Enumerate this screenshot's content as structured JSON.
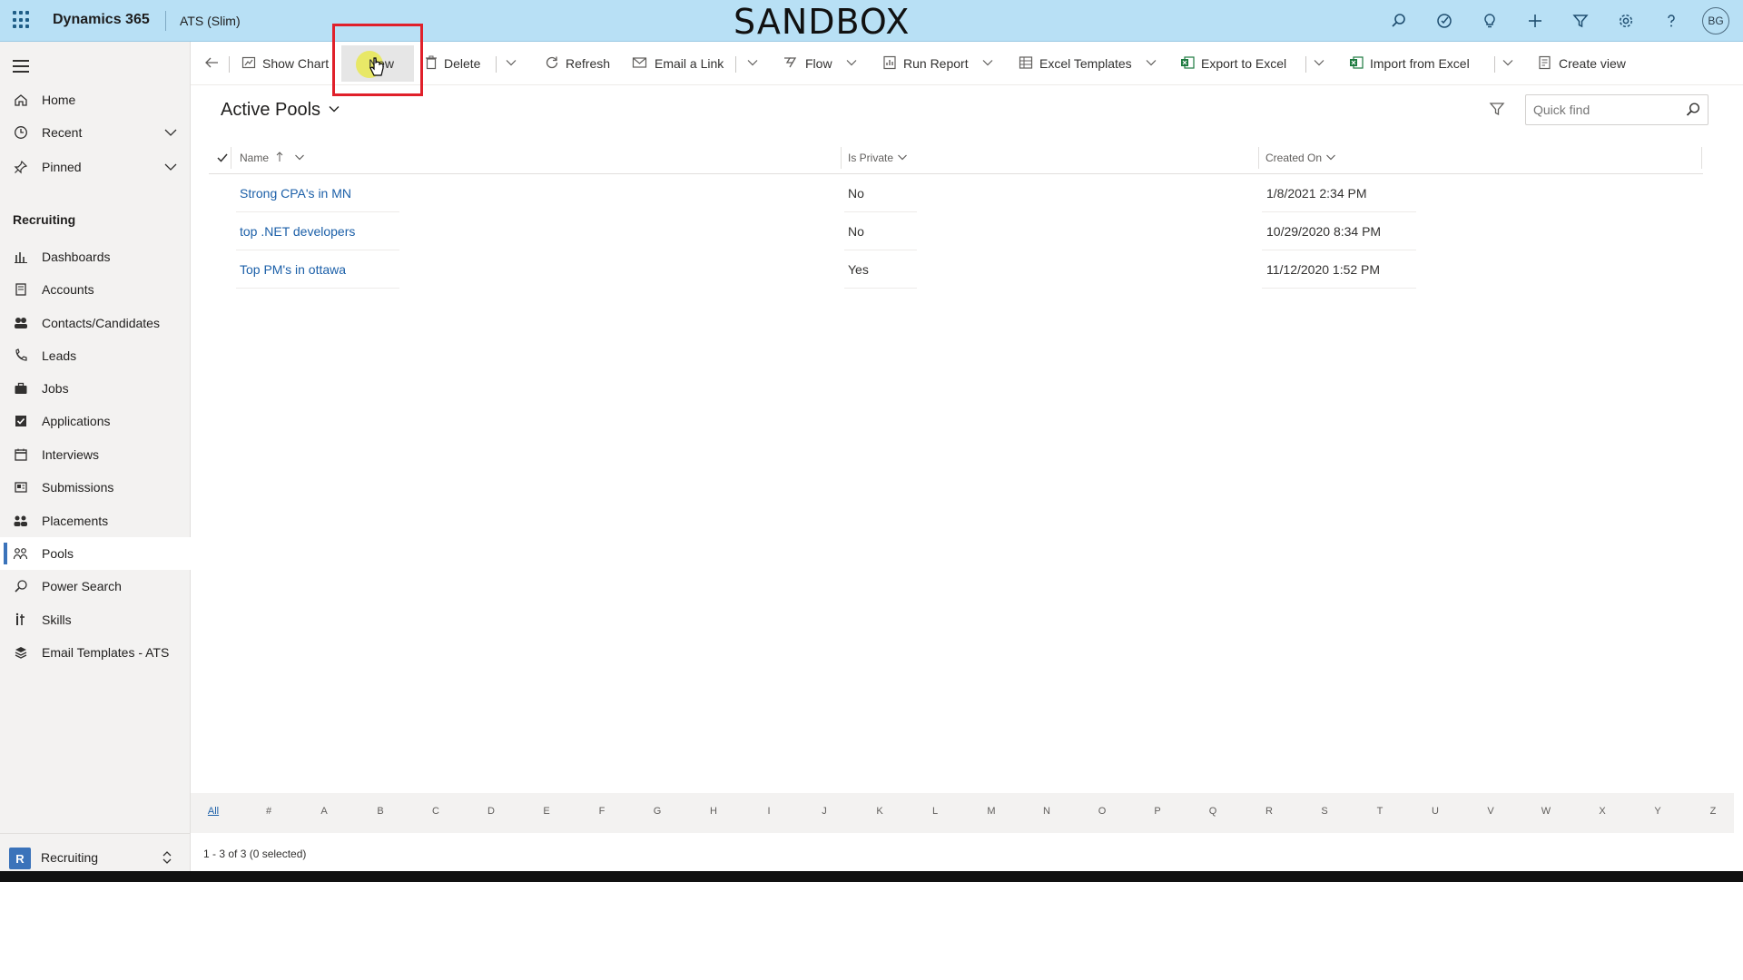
{
  "topbar": {
    "brand": "Dynamics 365",
    "app_name": "ATS (Slim)",
    "environment_banner": "SANDBOX",
    "user_initials": "BG",
    "icons": [
      "search-icon",
      "task-icon",
      "lightbulb-icon",
      "plus-icon",
      "filter-icon",
      "gear-icon",
      "help-icon"
    ]
  },
  "sidebar": {
    "top_items": [
      {
        "label": "Home",
        "icon": "home-icon"
      },
      {
        "label": "Recent",
        "icon": "clock-icon"
      },
      {
        "label": "Pinned",
        "icon": "pin-icon"
      }
    ],
    "section_title": "Recruiting",
    "items": [
      {
        "label": "Dashboards",
        "icon": "dashboard-icon"
      },
      {
        "label": "Accounts",
        "icon": "accounts-icon"
      },
      {
        "label": "Contacts/Candidates",
        "icon": "contacts-icon"
      },
      {
        "label": "Leads",
        "icon": "leads-icon"
      },
      {
        "label": "Jobs",
        "icon": "briefcase-icon"
      },
      {
        "label": "Applications",
        "icon": "checkbox-icon"
      },
      {
        "label": "Interviews",
        "icon": "calendar-icon"
      },
      {
        "label": "Submissions",
        "icon": "submissions-icon"
      },
      {
        "label": "Placements",
        "icon": "placements-icon"
      },
      {
        "label": "Pools",
        "icon": "pools-icon",
        "active": true
      },
      {
        "label": "Power Search",
        "icon": "search-icon"
      },
      {
        "label": "Skills",
        "icon": "skills-icon"
      },
      {
        "label": "Email Templates - ATS",
        "icon": "layers-icon"
      }
    ],
    "area": {
      "badge": "R",
      "label": "Recruiting"
    }
  },
  "commandbar": {
    "show_chart": "Show Chart",
    "new": "New",
    "delete": "Delete",
    "refresh": "Refresh",
    "email_link": "Email a Link",
    "flow": "Flow",
    "run_report": "Run Report",
    "excel_templates": "Excel Templates",
    "export_excel": "Export to Excel",
    "import_excel": "Import from Excel",
    "create_view": "Create view"
  },
  "view": {
    "title": "Active Pools",
    "quickfind_placeholder": "Quick find"
  },
  "grid": {
    "columns": [
      "Name",
      "Is Private",
      "Created On"
    ],
    "rows": [
      {
        "name": "Strong CPA's in MN",
        "is_private": "No",
        "created_on": "1/8/2021 2:34 PM"
      },
      {
        "name": "top .NET developers",
        "is_private": "No",
        "created_on": "10/29/2020 8:34 PM"
      },
      {
        "name": "Top PM's in ottawa",
        "is_private": "Yes",
        "created_on": "11/12/2020 1:52 PM"
      }
    ]
  },
  "alphabet": [
    "All",
    "#",
    "A",
    "B",
    "C",
    "D",
    "E",
    "F",
    "G",
    "H",
    "I",
    "J",
    "K",
    "L",
    "M",
    "N",
    "O",
    "P",
    "Q",
    "R",
    "S",
    "T",
    "U",
    "V",
    "W",
    "X",
    "Y",
    "Z"
  ],
  "status": "1 - 3 of 3 (0 selected)",
  "colors": {
    "topbar": "#b8e0f5",
    "link": "#1b5fa8",
    "accent": "#3b73ba",
    "highlight": "#e0202a"
  }
}
